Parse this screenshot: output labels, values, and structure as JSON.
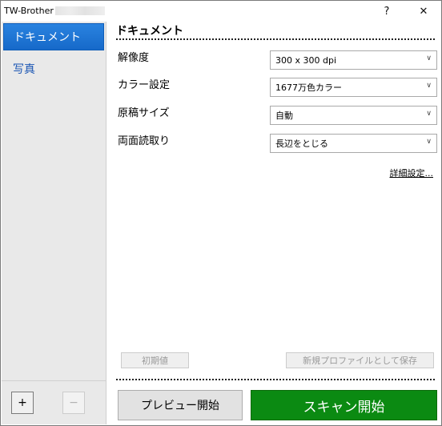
{
  "window": {
    "title": "TW-Brother",
    "help_glyph": "?",
    "close_glyph": "✕"
  },
  "sidebar": {
    "items": [
      {
        "label": "ドキュメント",
        "selected": true
      },
      {
        "label": "写真",
        "selected": false
      }
    ],
    "add_label": "+",
    "remove_label": "−"
  },
  "main": {
    "section_title": "ドキュメント",
    "settings": [
      {
        "label": "解像度",
        "value": "300 x 300 dpi"
      },
      {
        "label": "カラー設定",
        "value": "1677万色カラー"
      },
      {
        "label": "原稿サイズ",
        "value": "自動"
      },
      {
        "label": "両面読取り",
        "value": "長辺をとじる"
      }
    ],
    "advanced_link": "詳細設定...",
    "reset_label": "初期値",
    "save_profile_label": "新規プロファイルとして保存",
    "preview_label": "プレビュー開始",
    "scan_label": "スキャン開始"
  },
  "colors": {
    "sidebar_selected": "#1f76d6",
    "scan_button": "#0b8a12",
    "link_blue": "#1a55b3"
  }
}
